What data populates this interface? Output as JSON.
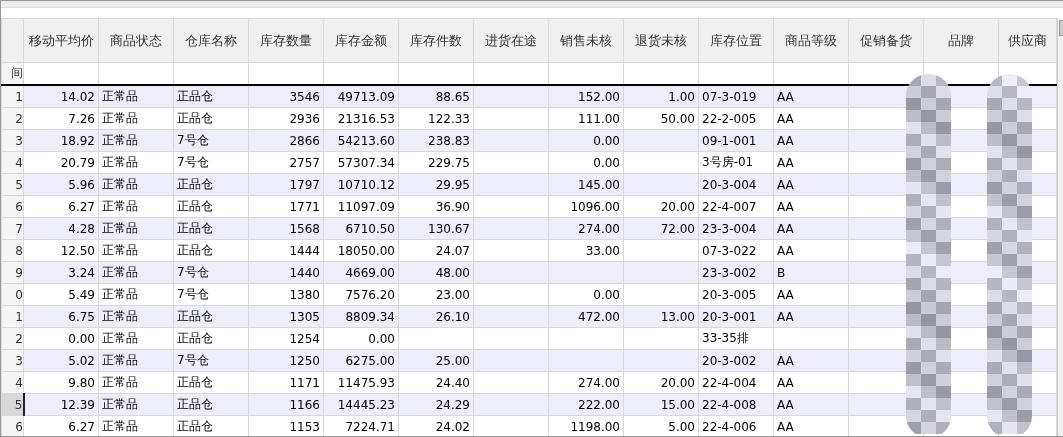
{
  "columns": [
    {
      "label": "移动平均价",
      "kind": "number"
    },
    {
      "label": "商品状态",
      "kind": "text"
    },
    {
      "label": "仓库名称",
      "kind": "text"
    },
    {
      "label": "库存数量",
      "kind": "number"
    },
    {
      "label": "库存金额",
      "kind": "number"
    },
    {
      "label": "库存件数",
      "kind": "number"
    },
    {
      "label": "进货在途",
      "kind": "number"
    },
    {
      "label": "销售未核",
      "kind": "number"
    },
    {
      "label": "退货未核",
      "kind": "number"
    },
    {
      "label": "库存位置",
      "kind": "text"
    },
    {
      "label": "商品等级",
      "kind": "text"
    },
    {
      "label": "促销备货",
      "kind": "text"
    },
    {
      "label": "品牌",
      "kind": "text"
    },
    {
      "label": "供应商",
      "kind": "text"
    }
  ],
  "filter_row": {
    "row_header": "间"
  },
  "rows": [
    {
      "number": "1",
      "selected": false,
      "cells": [
        "14.02",
        "正常品",
        "正品仓",
        "3546",
        "49713.09",
        "88.65",
        null,
        "152.00",
        "1.00",
        "07-3-019",
        "AA"
      ]
    },
    {
      "number": "2",
      "selected": false,
      "cells": [
        "7.26",
        "正常品",
        "正品仓",
        "2936",
        "21316.53",
        "122.33",
        null,
        "111.00",
        "50.00",
        "22-2-005",
        "AA"
      ]
    },
    {
      "number": "3",
      "selected": false,
      "cells": [
        "18.92",
        "正常品",
        "7号仓",
        "2866",
        "54213.60",
        "238.83",
        null,
        "0.00",
        null,
        "09-1-001",
        "AA"
      ]
    },
    {
      "number": "4",
      "selected": false,
      "cells": [
        "20.79",
        "正常品",
        "7号仓",
        "2757",
        "57307.34",
        "229.75",
        null,
        "0.00",
        null,
        "3号房-01",
        "AA"
      ]
    },
    {
      "number": "5",
      "selected": false,
      "cells": [
        "5.96",
        "正常品",
        "正品仓",
        "1797",
        "10710.12",
        "29.95",
        null,
        "145.00",
        null,
        "20-3-004",
        "AA"
      ]
    },
    {
      "number": "6",
      "selected": false,
      "cells": [
        "6.27",
        "正常品",
        "正品仓",
        "1771",
        "11097.09",
        "36.90",
        null,
        "1096.00",
        "20.00",
        "22-4-007",
        "AA"
      ]
    },
    {
      "number": "7",
      "selected": false,
      "cells": [
        "4.28",
        "正常品",
        "正品仓",
        "1568",
        "6710.50",
        "130.67",
        null,
        "274.00",
        "72.00",
        "23-3-004",
        "AA"
      ]
    },
    {
      "number": "8",
      "selected": false,
      "cells": [
        "12.50",
        "正常品",
        "正品仓",
        "1444",
        "18050.00",
        "24.07",
        null,
        "33.00",
        null,
        "07-3-022",
        "AA"
      ]
    },
    {
      "number": "9",
      "selected": false,
      "cells": [
        "3.24",
        "正常品",
        "7号仓",
        "1440",
        "4669.00",
        "48.00",
        null,
        null,
        null,
        "23-3-002",
        "B"
      ]
    },
    {
      "number": "0",
      "selected": false,
      "cells": [
        "5.49",
        "正常品",
        "7号仓",
        "1380",
        "7576.20",
        "23.00",
        null,
        "0.00",
        null,
        "20-3-005",
        "AA"
      ]
    },
    {
      "number": "1",
      "selected": false,
      "cells": [
        "6.75",
        "正常品",
        "正品仓",
        "1305",
        "8809.34",
        "26.10",
        null,
        "472.00",
        "13.00",
        "20-3-001",
        "AA"
      ]
    },
    {
      "number": "2",
      "selected": false,
      "cells": [
        "0.00",
        "正常品",
        "正品仓",
        "1254",
        "0.00",
        null,
        null,
        null,
        null,
        "33-35排"
      ]
    },
    {
      "number": "3",
      "selected": false,
      "cells": [
        "5.02",
        "正常品",
        "7号仓",
        "1250",
        "6275.00",
        "25.00",
        null,
        null,
        null,
        "20-3-002",
        "AA"
      ]
    },
    {
      "number": "4",
      "selected": false,
      "cells": [
        "9.80",
        "正常品",
        "正品仓",
        "1171",
        "11475.93",
        "24.40",
        null,
        "274.00",
        "20.00",
        "22-4-004",
        "AA"
      ]
    },
    {
      "number": "5",
      "selected": true,
      "cells": [
        "12.39",
        "正常品",
        "正品仓",
        "1166",
        "14445.23",
        "24.29",
        null,
        "222.00",
        "15.00",
        "22-4-008",
        "AA"
      ]
    },
    {
      "number": "6",
      "selected": false,
      "cells": [
        "6.27",
        "正常品",
        "正品仓",
        "1153",
        "7224.71",
        "24.02",
        null,
        "1198.00",
        "5.00",
        "22-4-006",
        "AA"
      ]
    }
  ]
}
